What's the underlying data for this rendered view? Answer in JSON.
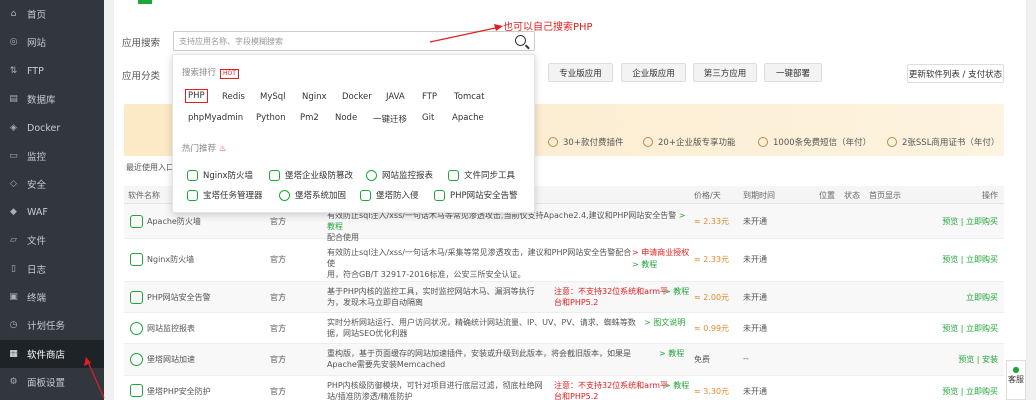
{
  "sidebar": {
    "items": [
      {
        "label": "首页",
        "icon": "home-icon",
        "glyph": "⌂"
      },
      {
        "label": "网站",
        "icon": "globe-icon",
        "glyph": "◎"
      },
      {
        "label": "FTP",
        "icon": "ftp-icon",
        "glyph": "⇅"
      },
      {
        "label": "数据库",
        "icon": "database-icon",
        "glyph": "▤"
      },
      {
        "label": "Docker",
        "icon": "docker-icon",
        "glyph": "◈"
      },
      {
        "label": "监控",
        "icon": "monitor-icon",
        "glyph": "▭"
      },
      {
        "label": "安全",
        "icon": "shield-icon",
        "glyph": "◇"
      },
      {
        "label": "WAF",
        "icon": "waf-icon",
        "glyph": "◆"
      },
      {
        "label": "文件",
        "icon": "folder-icon",
        "glyph": "▱"
      },
      {
        "label": "日志",
        "icon": "log-icon",
        "glyph": "▯"
      },
      {
        "label": "终端",
        "icon": "terminal-icon",
        "glyph": "▣"
      },
      {
        "label": "计划任务",
        "icon": "clock-icon",
        "glyph": "◷"
      },
      {
        "label": "软件商店",
        "icon": "apps-icon",
        "glyph": "▦"
      },
      {
        "label": "面板设置",
        "icon": "gear-icon",
        "glyph": "⚙"
      }
    ]
  },
  "search": {
    "label": "应用搜索",
    "placeholder": "支持应用名称、字段模糊搜索"
  },
  "annotation": "也可以自己搜索PHP",
  "category": {
    "label": "应用分类",
    "buttons": [
      "专业版应用",
      "企业版应用",
      "第三方应用",
      "一键部署"
    ],
    "update": "更新软件列表 / 支付状态"
  },
  "features": [
    "30+款付费插件",
    "20+企业版专享功能",
    "1000条免费短信（年付）",
    "2张SSL商用证书（年付）"
  ],
  "recent": "最近使用入口",
  "dropdown": {
    "rank_title": "搜索排行",
    "hot": "HOT",
    "rank_row1": [
      "PHP",
      "Redis",
      "MySql",
      "Nginx",
      "Docker",
      "JAVA",
      "FTP",
      "Tomcat"
    ],
    "rank_row2": [
      "phpMyadmin",
      "Python",
      "Pm2",
      "Node",
      "一键迁移",
      "Git",
      "Apache"
    ],
    "recommend_title": "热门推荐",
    "rec_row1": [
      "Nginx防火墙",
      "堡塔企业级防篡改",
      "网站监控报表",
      "文件同步工具"
    ],
    "rec_row2": [
      "宝塔任务管理器",
      "堡塔系统加固",
      "堡塔防入侵",
      "PHP网站安全告警"
    ]
  },
  "table": {
    "headers": {
      "name": "软件名称",
      "price": "价格/天",
      "expire": "到期时间",
      "position": "位置",
      "status": "状态",
      "home": "首页显示",
      "ops": "操作"
    },
    "rows": [
      {
        "name": "Apache防火墙",
        "dev": "官方",
        "desc": "有效防止sql注入/xss/一句话木马等常见渗透攻击,当前仅支持Apache2.4,建议和PHP网站安全告警",
        "red": "",
        "green": "> 教程",
        "desc2": "配合使用",
        "price": "≈ 2.33元",
        "expire": "未开通",
        "ops": "预览 | 立即购买"
      },
      {
        "name": "Nginx防火墙",
        "dev": "官方",
        "desc": "有效防止sql注入/xss/一句话木马/采集等常见渗透攻击，建议和PHP网站安全告警配合使",
        "red": "> 申请商业授权",
        "green": "> 教程",
        "desc2": "用，符合GB/T 32917-2016标准，公安三所安全认证。",
        "price": "≈ 2.33元",
        "expire": "未开通",
        "ops": "预览 | 立即购买"
      },
      {
        "name": "PHP网站安全告警",
        "dev": "官方",
        "desc": "基于PHP内核的监控工具，实时监控网站木马、漏洞等执行",
        "red": "注意：不支持32位系统和arm平台和PHP5.2",
        "green": "> 教程",
        "desc2": "为，发现木马立即自动隔离",
        "price": "≈ 2.00元",
        "expire": "未开通",
        "ops": "立即购买"
      },
      {
        "name": "网站监控报表",
        "dev": "官方",
        "desc": "实时分析网站运行、用户访问状况，精确统计网站流量、IP、UV、PV、请求、蜘蛛等数据，网",
        "red": "",
        "green": "> 图文说明",
        "desc2": "站SEO优化利器",
        "price": "≈ 0.99元",
        "expire": "未开通",
        "ops": "预览 | 立即购买"
      },
      {
        "name": "堡塔网站加速",
        "dev": "官方",
        "desc": "重构版，基于页面缓存的网站加速插件，安装或升级到此版本，将会截旧版本，如果是Apache需",
        "red": "",
        "green": "> 教程",
        "desc2": "要先安装Memcached",
        "price": "免费",
        "expire": "--",
        "ops": "预览 | 安装"
      },
      {
        "name": "堡塔PHP安全防护",
        "dev": "官方",
        "desc": "PHP内核级防御模块，可针对项目进行底层过滤，彻底杜绝网站/插",
        "red": "注意：不支持32位系统和arm平台和PHP5.2",
        "green": "> 教程",
        "desc2": "准防渗透/精准防护",
        "price": "≈ 3.30元",
        "expire": "未开通",
        "ops": "预览 | 立即购买"
      }
    ]
  },
  "float_label": "客服"
}
